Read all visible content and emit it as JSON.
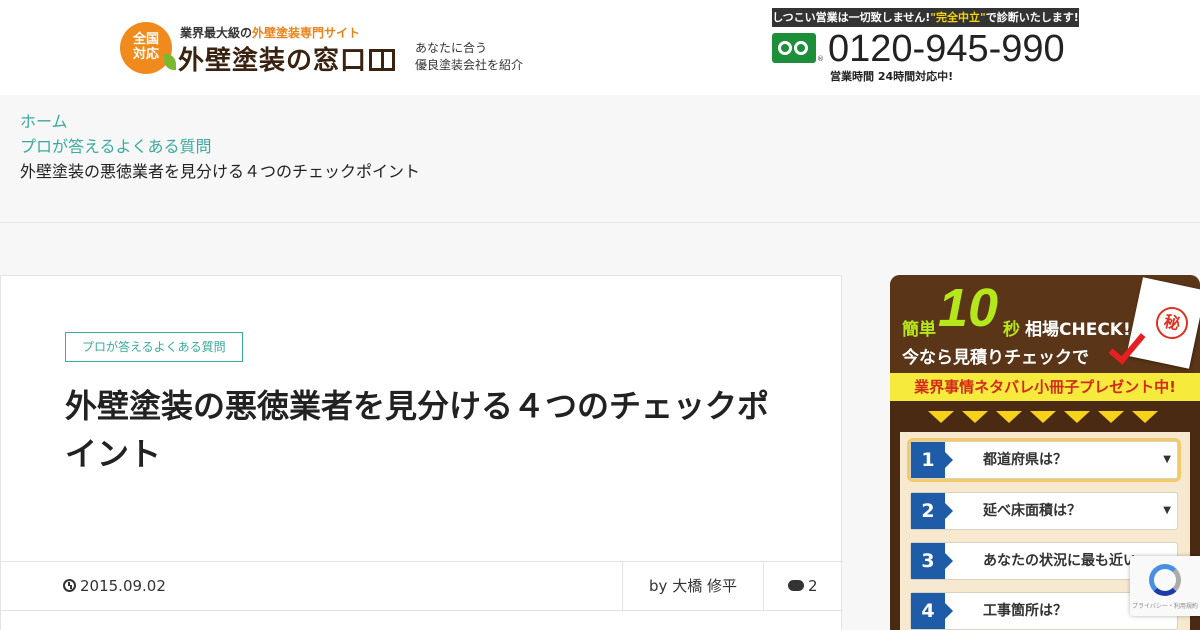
{
  "header": {
    "logo_badge": "全国\n対応",
    "logo_sub_prefix": "業界最大級の",
    "logo_sub_highlight": "外壁塗装専門サイト",
    "logo_main": "外壁塗装の窓口",
    "tagline_line1": "あなたに合う",
    "tagline_line2": "優良塗装会社を紹介",
    "tel_note_prefix": "しつこい営業は一切致しません!",
    "tel_note_highlight": "\"完全中立\"",
    "tel_note_suffix": "で診断いたします!",
    "tel_number": "0120-945-990",
    "tel_hours": "営業時間 24時間対応中!"
  },
  "breadcrumb": {
    "home": "ホーム",
    "category": "プロが答えるよくある質問",
    "current": "外壁塗装の悪徳業者を見分ける４つのチェックポイント"
  },
  "article": {
    "category_tag": "プロが答えるよくある質問",
    "title": "外壁塗装の悪徳業者を見分ける４つのチェックポイント",
    "date": "2015.09.02",
    "author": "by 大橋 修平",
    "comment_count": "2"
  },
  "widget": {
    "kantan": "簡単",
    "ten": "10",
    "byo": "秒",
    "check": "相場CHECK!",
    "line2": "今なら見積りチェックで",
    "secret": "秘",
    "ribbon": "業界事情ネタバレ小冊子プレゼント中!",
    "questions": [
      {
        "num": "1",
        "label": "都道府県は？"
      },
      {
        "num": "2",
        "label": "延べ床面積は？"
      },
      {
        "num": "3",
        "label": "あなたの状況に最も近い"
      },
      {
        "num": "4",
        "label": "工事箇所は？"
      }
    ]
  },
  "recaptcha": {
    "text": "プライバシー・利用規約"
  }
}
